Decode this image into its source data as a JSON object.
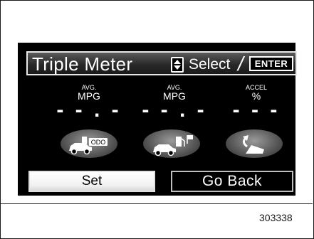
{
  "header": {
    "title": "Triple Meter",
    "select_label": "Select",
    "separator": "/",
    "enter_key": "ENTER"
  },
  "meters": [
    {
      "label_small": "AVG.",
      "label_unit": "MPG",
      "value": "- - . -"
    },
    {
      "label_small": "AVG.",
      "label_unit": "MPG",
      "value": "- - . -"
    },
    {
      "label_small": "ACCEL",
      "label_unit": "%",
      "value": "- - -"
    }
  ],
  "icon_buttons": [
    {
      "icon": "car-fuel-odo-icon",
      "text": "ODO"
    },
    {
      "icon": "car-fuel-flag-icon"
    },
    {
      "icon": "accel-pedal-icon"
    }
  ],
  "buttons": {
    "set": "Set",
    "go_back": "Go Back"
  },
  "figure_number": "303338"
}
